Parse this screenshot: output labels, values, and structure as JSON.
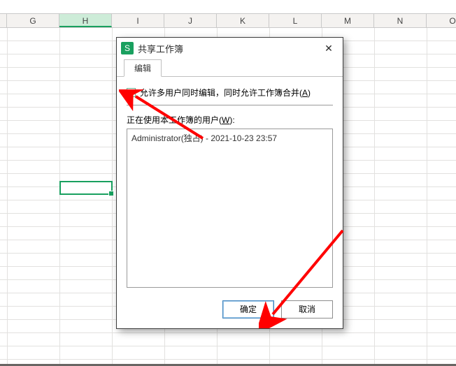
{
  "columns": [
    "G",
    "H",
    "I",
    "J",
    "K",
    "L",
    "M",
    "N",
    "O"
  ],
  "selectedColumn": "H",
  "dialog": {
    "title": "共享工作簿",
    "tabs": {
      "edit": "编辑"
    },
    "checkbox_label_pre": "允许多用户同时编辑，同时允许工作簿合并(",
    "checkbox_hotkey": "A",
    "checkbox_label_post": ")",
    "users_label_pre": "正在使用本工作簿的用户(",
    "users_hotkey": "W",
    "users_label_post": "):",
    "users": [
      "Administrator(独占) - 2021-10-23 23:57"
    ],
    "ok": "确定",
    "cancel": "取消",
    "app_icon_letter": "S"
  }
}
